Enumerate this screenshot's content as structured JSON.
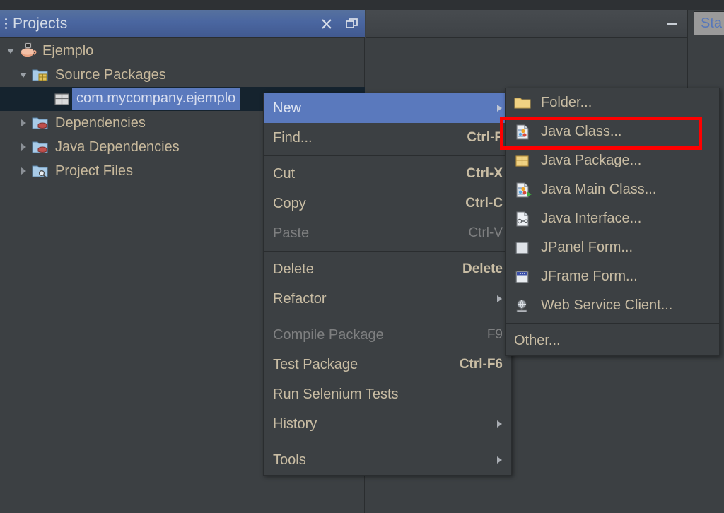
{
  "window": {
    "panel_title": "Projects",
    "close_label": "×",
    "maximize_label": "❐",
    "minimize_label": "—",
    "editor_tab_label": "Sta"
  },
  "tree": {
    "items": [
      {
        "label": "Ejemplo",
        "icon": "java-coffee-cup-icon",
        "twisty": "expanded",
        "depth": 0,
        "selected": false
      },
      {
        "label": "Source Packages",
        "icon": "source-packages-folder-icon",
        "twisty": "expanded",
        "depth": 1,
        "selected": false
      },
      {
        "label": "com.mycompany.ejemplo",
        "icon": "java-package-icon",
        "twisty": "none",
        "depth": 2,
        "selected": true
      },
      {
        "label": "Dependencies",
        "icon": "dependencies-folder-icon",
        "twisty": "collapsed",
        "depth": 1,
        "selected": false
      },
      {
        "label": "Java Dependencies",
        "icon": "java-dependencies-folder-icon",
        "twisty": "collapsed",
        "depth": 1,
        "selected": false
      },
      {
        "label": "Project Files",
        "icon": "project-files-folder-icon",
        "twisty": "collapsed",
        "depth": 1,
        "selected": false
      }
    ]
  },
  "context_menu": {
    "items": [
      {
        "label": "New",
        "accel": "",
        "submenu": true,
        "selected": true,
        "disabled": false,
        "sep_after": false
      },
      {
        "label": "Find...",
        "accel": "Ctrl-F",
        "submenu": false,
        "selected": false,
        "disabled": false,
        "sep_after": true
      },
      {
        "label": "Cut",
        "accel": "Ctrl-X",
        "submenu": false,
        "selected": false,
        "disabled": false,
        "sep_after": false
      },
      {
        "label": "Copy",
        "accel": "Ctrl-C",
        "submenu": false,
        "selected": false,
        "disabled": false,
        "sep_after": false
      },
      {
        "label": "Paste",
        "accel": "Ctrl-V",
        "submenu": false,
        "selected": false,
        "disabled": true,
        "sep_after": true
      },
      {
        "label": "Delete",
        "accel": "Delete",
        "submenu": false,
        "selected": false,
        "disabled": false,
        "sep_after": false
      },
      {
        "label": "Refactor",
        "accel": "",
        "submenu": true,
        "selected": false,
        "disabled": false,
        "sep_after": true
      },
      {
        "label": "Compile Package",
        "accel": "F9",
        "submenu": false,
        "selected": false,
        "disabled": true,
        "sep_after": false
      },
      {
        "label": "Test Package",
        "accel": "Ctrl-F6",
        "submenu": false,
        "selected": false,
        "disabled": false,
        "sep_after": false
      },
      {
        "label": "Run Selenium Tests",
        "accel": "",
        "submenu": false,
        "selected": false,
        "disabled": false,
        "sep_after": false
      },
      {
        "label": "History",
        "accel": "",
        "submenu": true,
        "selected": false,
        "disabled": false,
        "sep_after": true
      },
      {
        "label": "Tools",
        "accel": "",
        "submenu": true,
        "selected": false,
        "disabled": false,
        "sep_after": false
      }
    ]
  },
  "submenu": {
    "items": [
      {
        "label": "Folder...",
        "icon": "folder-icon",
        "sep_after": false
      },
      {
        "label": "Java Class...",
        "icon": "java-class-icon",
        "sep_after": false,
        "highlighted": true
      },
      {
        "label": "Java Package...",
        "icon": "java-package-icon",
        "sep_after": false
      },
      {
        "label": "Java Main Class...",
        "icon": "java-main-class-icon",
        "sep_after": false
      },
      {
        "label": "Java Interface...",
        "icon": "java-interface-icon",
        "sep_after": false
      },
      {
        "label": "JPanel Form...",
        "icon": "jpanel-form-icon",
        "sep_after": false
      },
      {
        "label": "JFrame Form...",
        "icon": "jframe-form-icon",
        "sep_after": false
      },
      {
        "label": "Web Service Client...",
        "icon": "web-service-client-icon",
        "sep_after": true
      },
      {
        "label": "Other...",
        "icon": "",
        "sep_after": false
      }
    ]
  },
  "annotation": {
    "highlight_color": "#ff0000",
    "highlight_target": "Java Class..."
  },
  "colors": {
    "panel_bg": "#3c4043",
    "menu_bg": "#3c4043",
    "selection_blue": "#5a79bd",
    "titlebar_blue": "#4a66a0",
    "text": "#c9bda4",
    "text_disabled": "#7e7f80",
    "border": "#2a2d2f",
    "tree_selected_bg": "#15232e"
  }
}
